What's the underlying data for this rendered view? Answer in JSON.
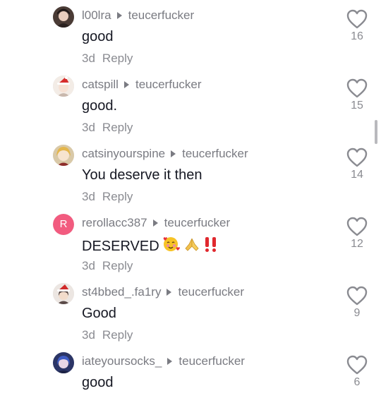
{
  "comments": [
    {
      "username": "l00lra",
      "reply_to": "teucerfucker",
      "text": "good",
      "age": "3d",
      "reply_label": "Reply",
      "likes": "16",
      "avatar_icon": "avatar-dark-hair-icon"
    },
    {
      "username": "catspill",
      "reply_to": "teucerfucker",
      "text": "good.",
      "age": "3d",
      "reply_label": "Reply",
      "likes": "15",
      "avatar_icon": "avatar-santa-hat-icon"
    },
    {
      "username": "catsinyourspine",
      "reply_to": "teucerfucker",
      "text": "You deserve it then",
      "age": "3d",
      "reply_label": "Reply",
      "likes": "14",
      "avatar_icon": "avatar-blonde-icon"
    },
    {
      "username": "rerollacc387",
      "reply_to": "teucerfucker",
      "text": "DESERVED",
      "age": "3d",
      "reply_label": "Reply",
      "likes": "12",
      "avatar_letter": "R",
      "emojis": [
        "smiling-face-with-hearts",
        "folded-hands",
        "double-exclamation"
      ]
    },
    {
      "username": "st4bbed_.fa1ry",
      "reply_to": "teucerfucker",
      "text": "Good",
      "age": "3d",
      "reply_label": "Reply",
      "likes": "9",
      "avatar_icon": "avatar-santa-hat-dark-icon"
    },
    {
      "username": "iateyoursocks_",
      "reply_to": "teucerfucker",
      "text": "good",
      "age": "",
      "reply_label": "",
      "likes": "6",
      "avatar_icon": "avatar-blue-hair-icon"
    }
  ],
  "colors": {
    "meta_text": "#7a7b82",
    "body_text": "#161823",
    "letter_avatar_bg": "#f25b7f",
    "heart_outline": "#8a8b91",
    "exclamation_red": "#e0282e"
  }
}
